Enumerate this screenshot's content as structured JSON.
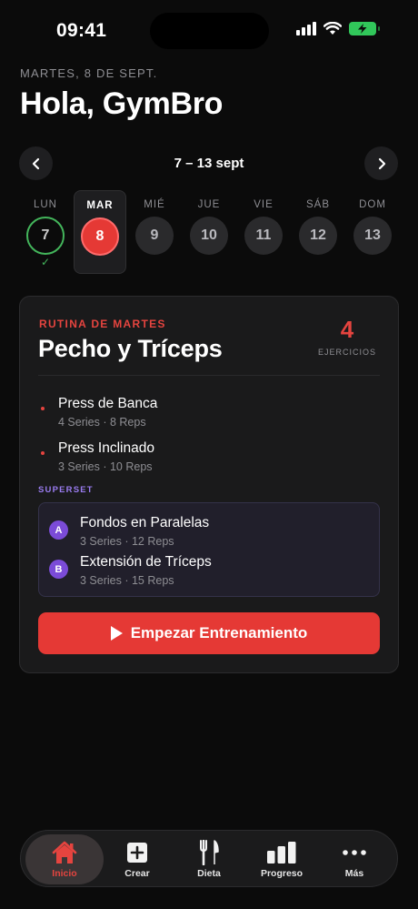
{
  "status_bar": {
    "time": "09:41"
  },
  "header": {
    "date": "MARTES, 8 DE SEPT.",
    "greeting": "Hola, GymBro"
  },
  "week": {
    "label": "7 – 13 sept",
    "days": [
      {
        "label": "LUN",
        "number": "7",
        "state": "done"
      },
      {
        "label": "MAR",
        "number": "8",
        "state": "selected"
      },
      {
        "label": "MIÉ",
        "number": "9",
        "state": "upcoming"
      },
      {
        "label": "JUE",
        "number": "10",
        "state": "upcoming"
      },
      {
        "label": "VIE",
        "number": "11",
        "state": "upcoming"
      },
      {
        "label": "SÁB",
        "number": "12",
        "state": "upcoming"
      },
      {
        "label": "DOM",
        "number": "13",
        "state": "upcoming"
      }
    ],
    "check_icon": "✓"
  },
  "routine": {
    "tag": "RUTINA DE MARTES",
    "title": "Pecho y Tríceps",
    "exercise_count": "4",
    "exercise_count_label": "EJERCICIOS",
    "exercises": [
      {
        "name": "Press de Banca",
        "meta": "4 Series · 8 Reps"
      },
      {
        "name": "Press Inclinado",
        "meta": "3 Series · 10 Reps"
      }
    ],
    "superset_label": "SUPERSET",
    "superset": [
      {
        "badge": "A",
        "name": "Fondos en Paralelas",
        "meta": "3 Series · 12 Reps"
      },
      {
        "badge": "B",
        "name": "Extensión de Tríceps",
        "meta": "3 Series · 15 Reps"
      }
    ],
    "start_button": "Empezar Entrenamiento"
  },
  "tabbar": {
    "tabs": [
      {
        "label": "Inicio",
        "icon": "home-icon",
        "active": true
      },
      {
        "label": "Crear",
        "icon": "plus-square-icon",
        "active": false
      },
      {
        "label": "Dieta",
        "icon": "fork-knife-icon",
        "active": false
      },
      {
        "label": "Progreso",
        "icon": "bar-chart-icon",
        "active": false
      },
      {
        "label": "Más",
        "icon": "more-icon",
        "active": false
      }
    ]
  },
  "colors": {
    "accent": "#e53935",
    "success": "#43b55b",
    "superset": "#7b4bd8",
    "background": "#0b0b0b",
    "card": "#1a1a1b"
  }
}
